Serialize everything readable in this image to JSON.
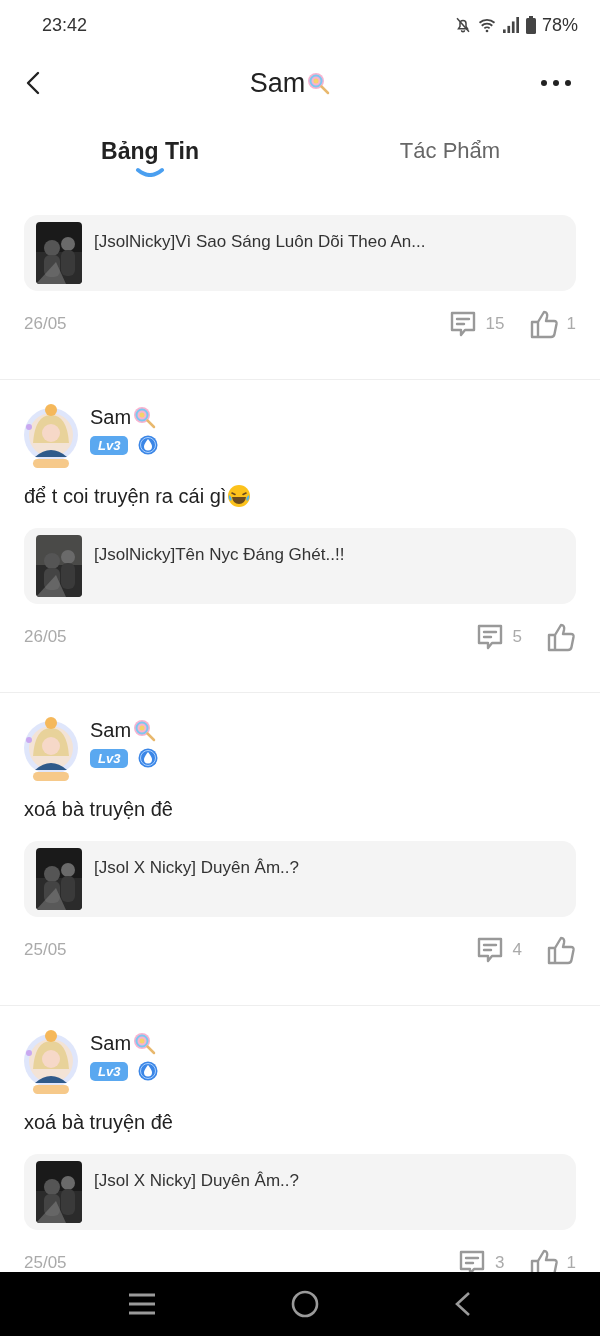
{
  "status_bar": {
    "time": "23:42",
    "battery": "78%"
  },
  "header": {
    "title": "Sam"
  },
  "tabs": [
    {
      "label": "Bảng Tin",
      "selected": true
    },
    {
      "label": "Tác Phẩm",
      "selected": false
    }
  ],
  "posts": [
    {
      "story": {
        "title": "[JsolNicky]Vì Sao Sáng Luôn Dõi Theo An..."
      },
      "date": "26/05",
      "comments": "15",
      "likes": "1"
    },
    {
      "author": {
        "name": "Sam",
        "level": "Lv3"
      },
      "text": "để t coi truyện ra cái gì",
      "emoji": true,
      "story": {
        "title": "[JsolNicky]Tên Nyc Đáng Ghét..!!"
      },
      "date": "26/05",
      "comments": "5"
    },
    {
      "author": {
        "name": "Sam",
        "level": "Lv3"
      },
      "text": "xoá bà truyện đê",
      "emoji": false,
      "story": {
        "title": "[Jsol X Nicky] Duyên Âm..?"
      },
      "date": "25/05",
      "comments": "4"
    },
    {
      "author": {
        "name": "Sam",
        "level": "Lv3"
      },
      "text": "xoá bà truyện đê",
      "emoji": false,
      "story": {
        "title": "[Jsol X Nicky] Duyên Âm..?"
      },
      "date": "25/05",
      "comments": "3",
      "likes": "1"
    }
  ]
}
